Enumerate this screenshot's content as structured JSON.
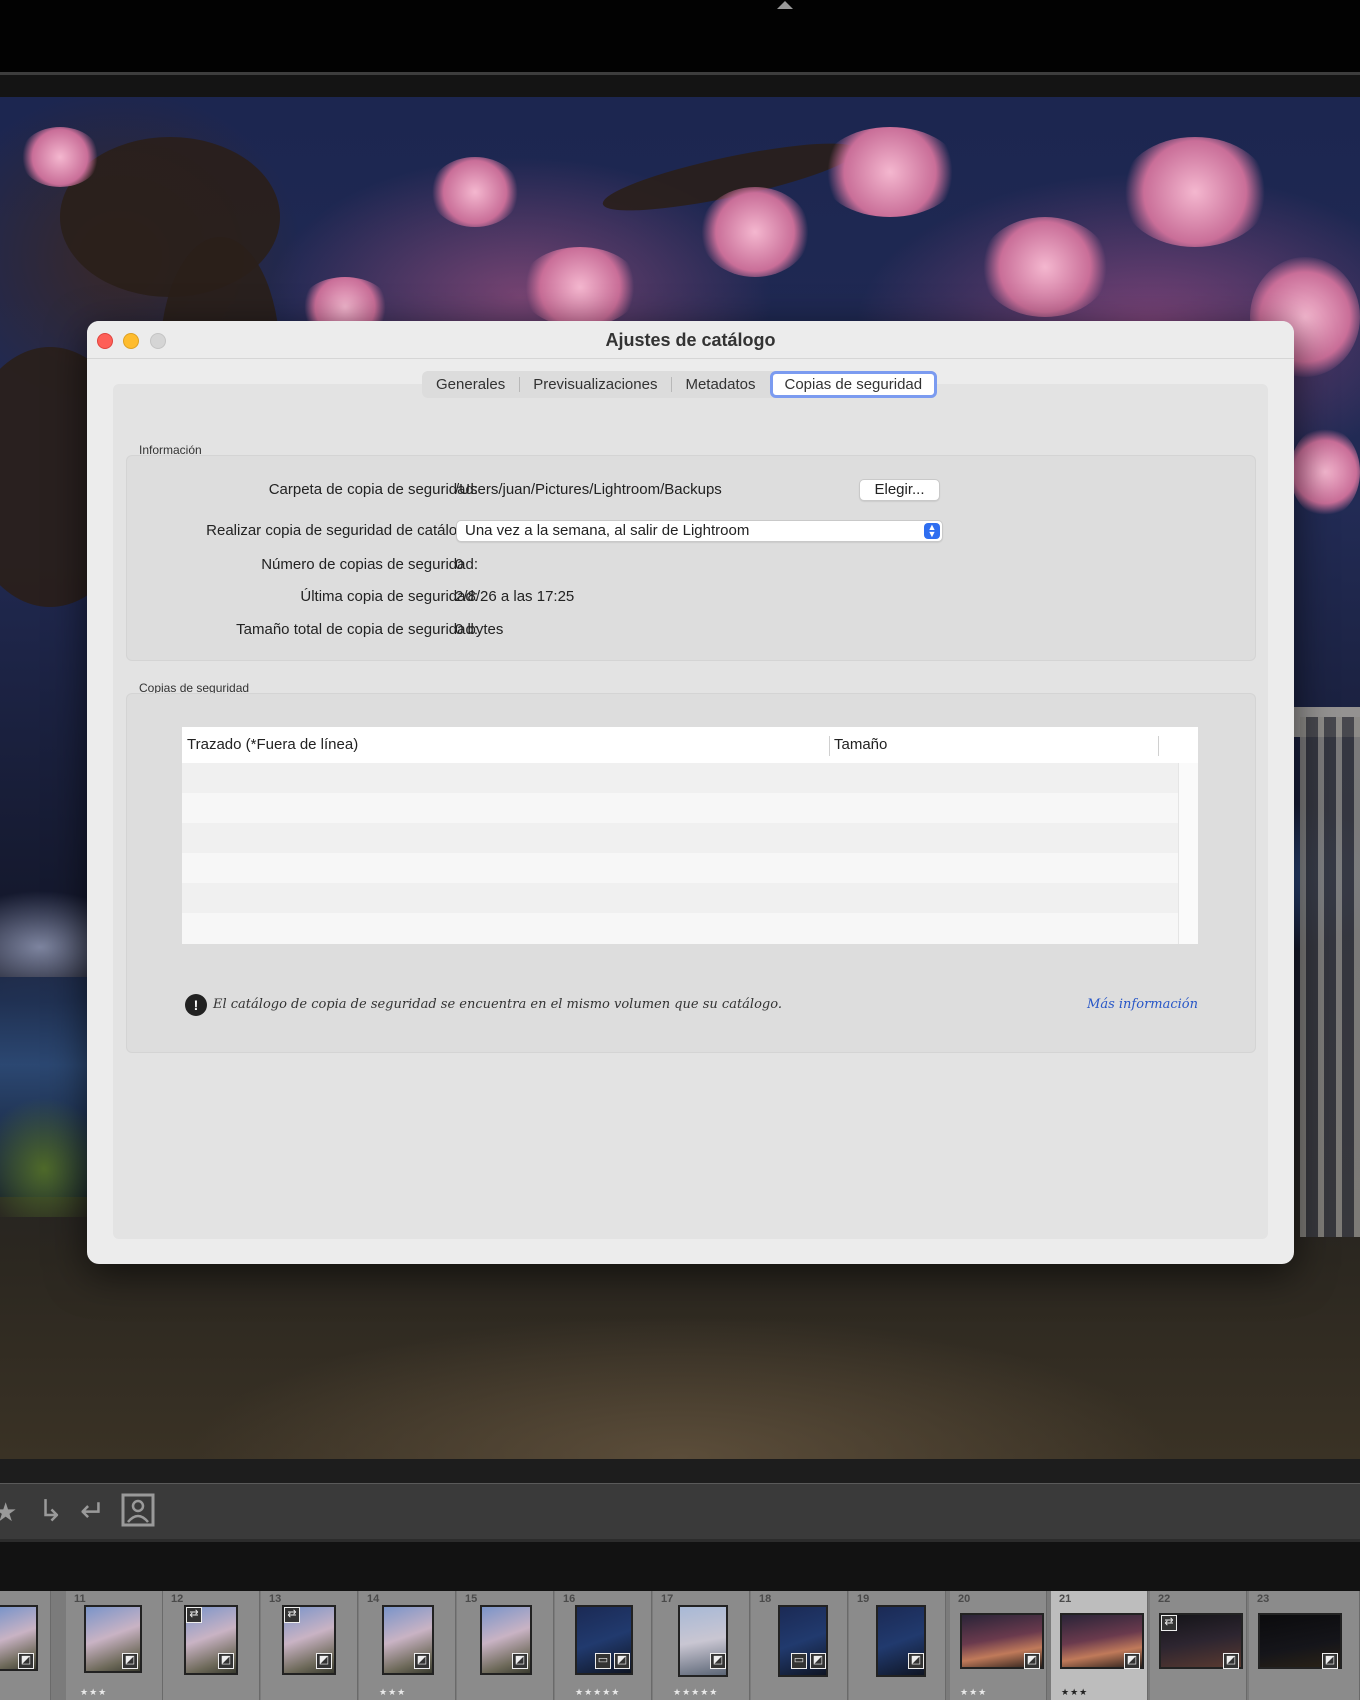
{
  "dialog": {
    "title": "Ajustes de catálogo",
    "tabs": [
      "Generales",
      "Previsualizaciones",
      "Metadatos",
      "Copias de seguridad"
    ],
    "active_tab": "Copias de seguridad",
    "info_section": {
      "label": "Información",
      "folder_label": "Carpeta de copia de seguridad:",
      "folder_value": "/Users/juan/Pictures/Lightroom/Backups",
      "choose_button": "Elegir...",
      "frequency_label": "Realizar copia de seguridad de catálogo:",
      "frequency_value": "Una vez a la semana, al salir de Lightroom",
      "count_label": "Número de copias de seguridad:",
      "count_value": "0",
      "last_label": "Última copia de seguridad:",
      "last_value": "2/8/26 a las 17:25",
      "size_label": "Tamaño total de copia de seguridad:",
      "size_value": "0 bytes"
    },
    "backups_section": {
      "label": "Copias de seguridad",
      "columns": [
        "Trazado (*Fuera de línea)",
        "Tamaño"
      ],
      "rows": []
    },
    "warning_text": "El catálogo de copia de seguridad se encuentra en el mismo volumen que su catálogo.",
    "more_info_link": "Más información"
  },
  "filmstrip": {
    "cells": [
      {
        "num": "",
        "stars": ""
      },
      {
        "num": "11",
        "stars": "★★★"
      },
      {
        "num": "12",
        "stars": ""
      },
      {
        "num": "13",
        "stars": ""
      },
      {
        "num": "14",
        "stars": "★★★"
      },
      {
        "num": "15",
        "stars": ""
      },
      {
        "num": "16",
        "stars": "★★★★★"
      },
      {
        "num": "17",
        "stars": "★★★★★"
      },
      {
        "num": "18",
        "stars": ""
      },
      {
        "num": "19",
        "stars": ""
      },
      {
        "num": "20",
        "stars": "★★★"
      },
      {
        "num": "21",
        "stars": "★★★"
      },
      {
        "num": "22",
        "stars": ""
      },
      {
        "num": "23",
        "stars": ""
      }
    ],
    "selected": "21"
  },
  "colors": {
    "accent": "#2f6ef0",
    "tab_focus": "#7b9bf0",
    "link": "#2756c7"
  }
}
